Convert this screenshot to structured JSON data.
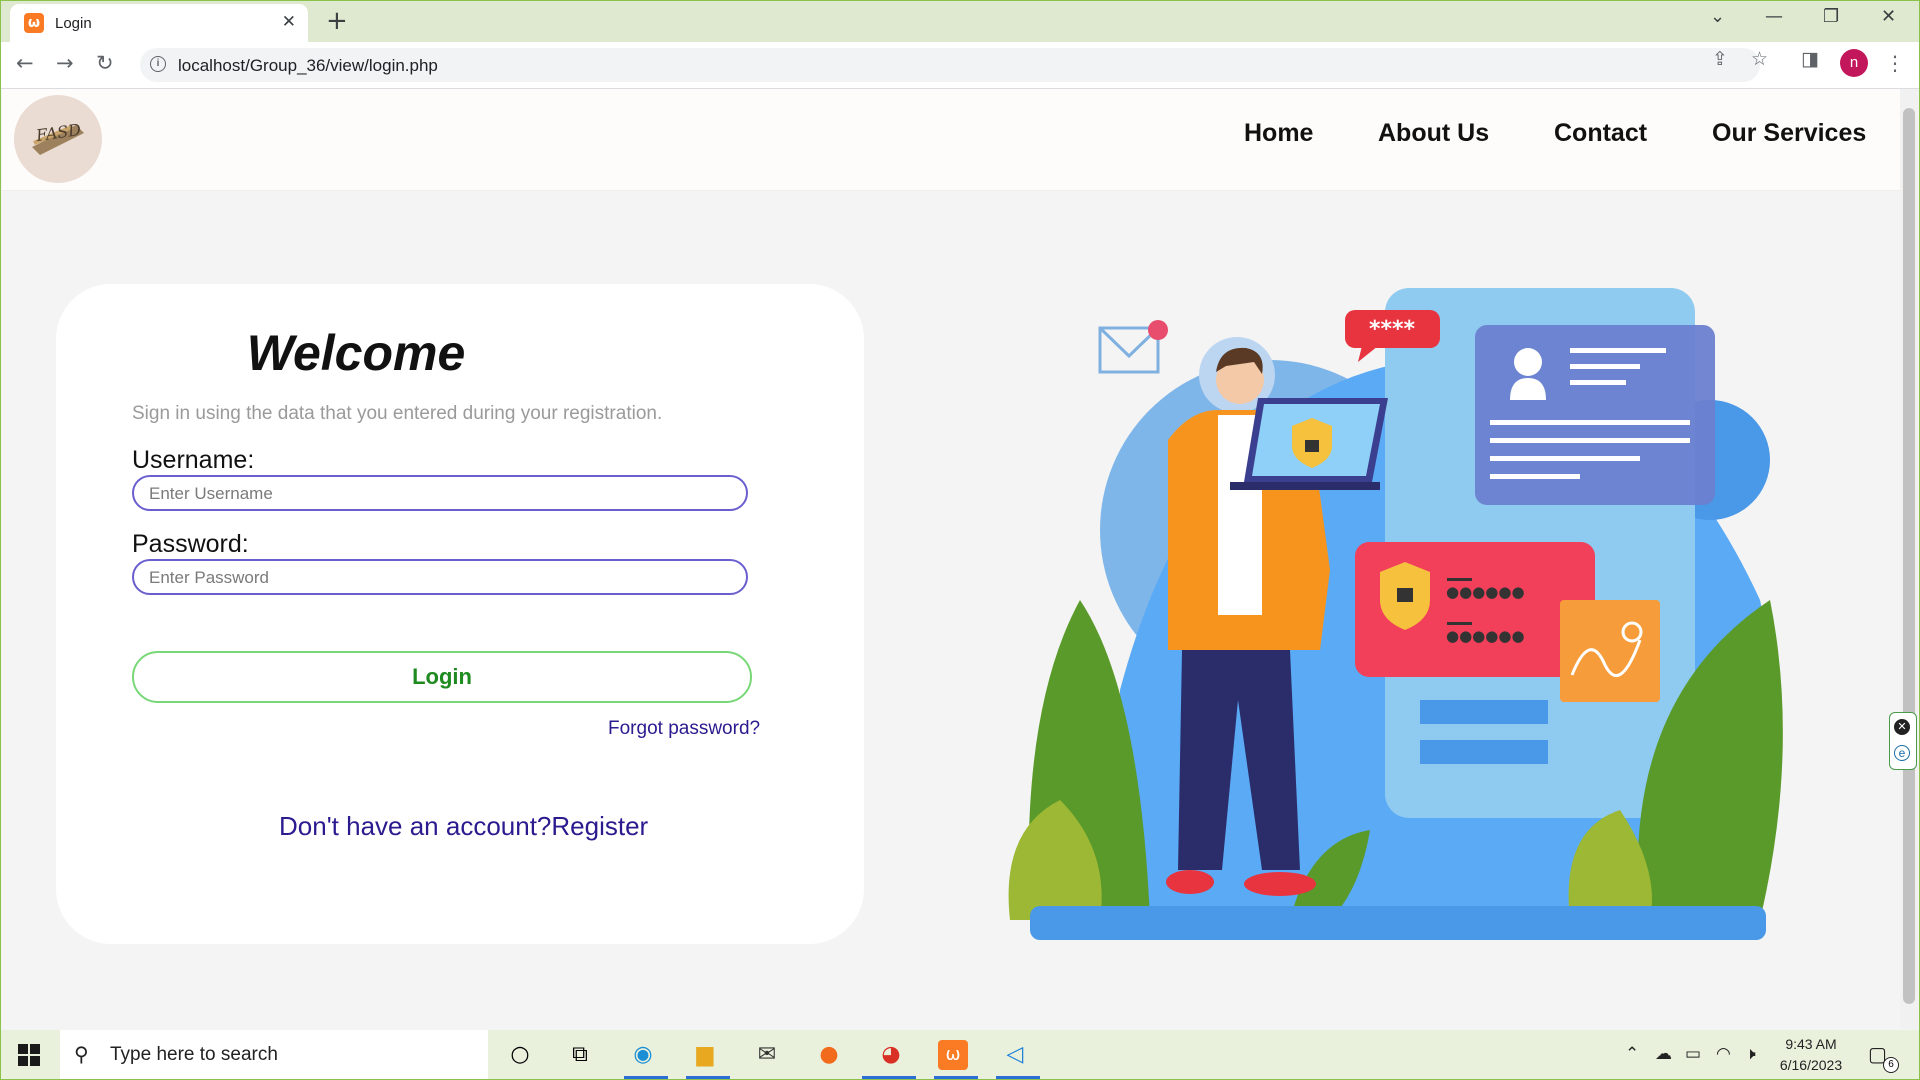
{
  "browser": {
    "tab_title": "Login",
    "tab_favicon": "xampp-icon",
    "new_tab_symbol": "+",
    "url": "localhost/Group_36/view/login.php",
    "profile_initial": "n"
  },
  "site": {
    "logo_text": "FASD",
    "nav": {
      "home": "Home",
      "about": "About Us",
      "contact": "Contact",
      "services": "Our Services"
    }
  },
  "login": {
    "title": "Welcome",
    "subtitle": "Sign in using the data that you entered during your registration.",
    "username_label": "Username:",
    "username_placeholder": "Enter Username",
    "username_value": "",
    "password_label": "Password:",
    "password_placeholder": "Enter Password",
    "password_value": "",
    "login_button": "Login",
    "forgot_link": "Forgot password?",
    "register_link": "Don't have an account?Register"
  },
  "illustration": {
    "bubble_text": "****",
    "password_mask": "●●●●●●",
    "accent_colors": {
      "blue": "#5aaaf5",
      "red": "#f2405b",
      "orange": "#f79c3a",
      "green": "#5a9a2a"
    }
  },
  "taskbar": {
    "search_placeholder": "Type here to search",
    "time": "9:43 AM",
    "date": "6/16/2023",
    "notification_count": "6"
  },
  "colors": {
    "accent_input_border": "#6a5fcf",
    "login_button_border": "#78d878",
    "link_color": "#2b1b8f"
  }
}
